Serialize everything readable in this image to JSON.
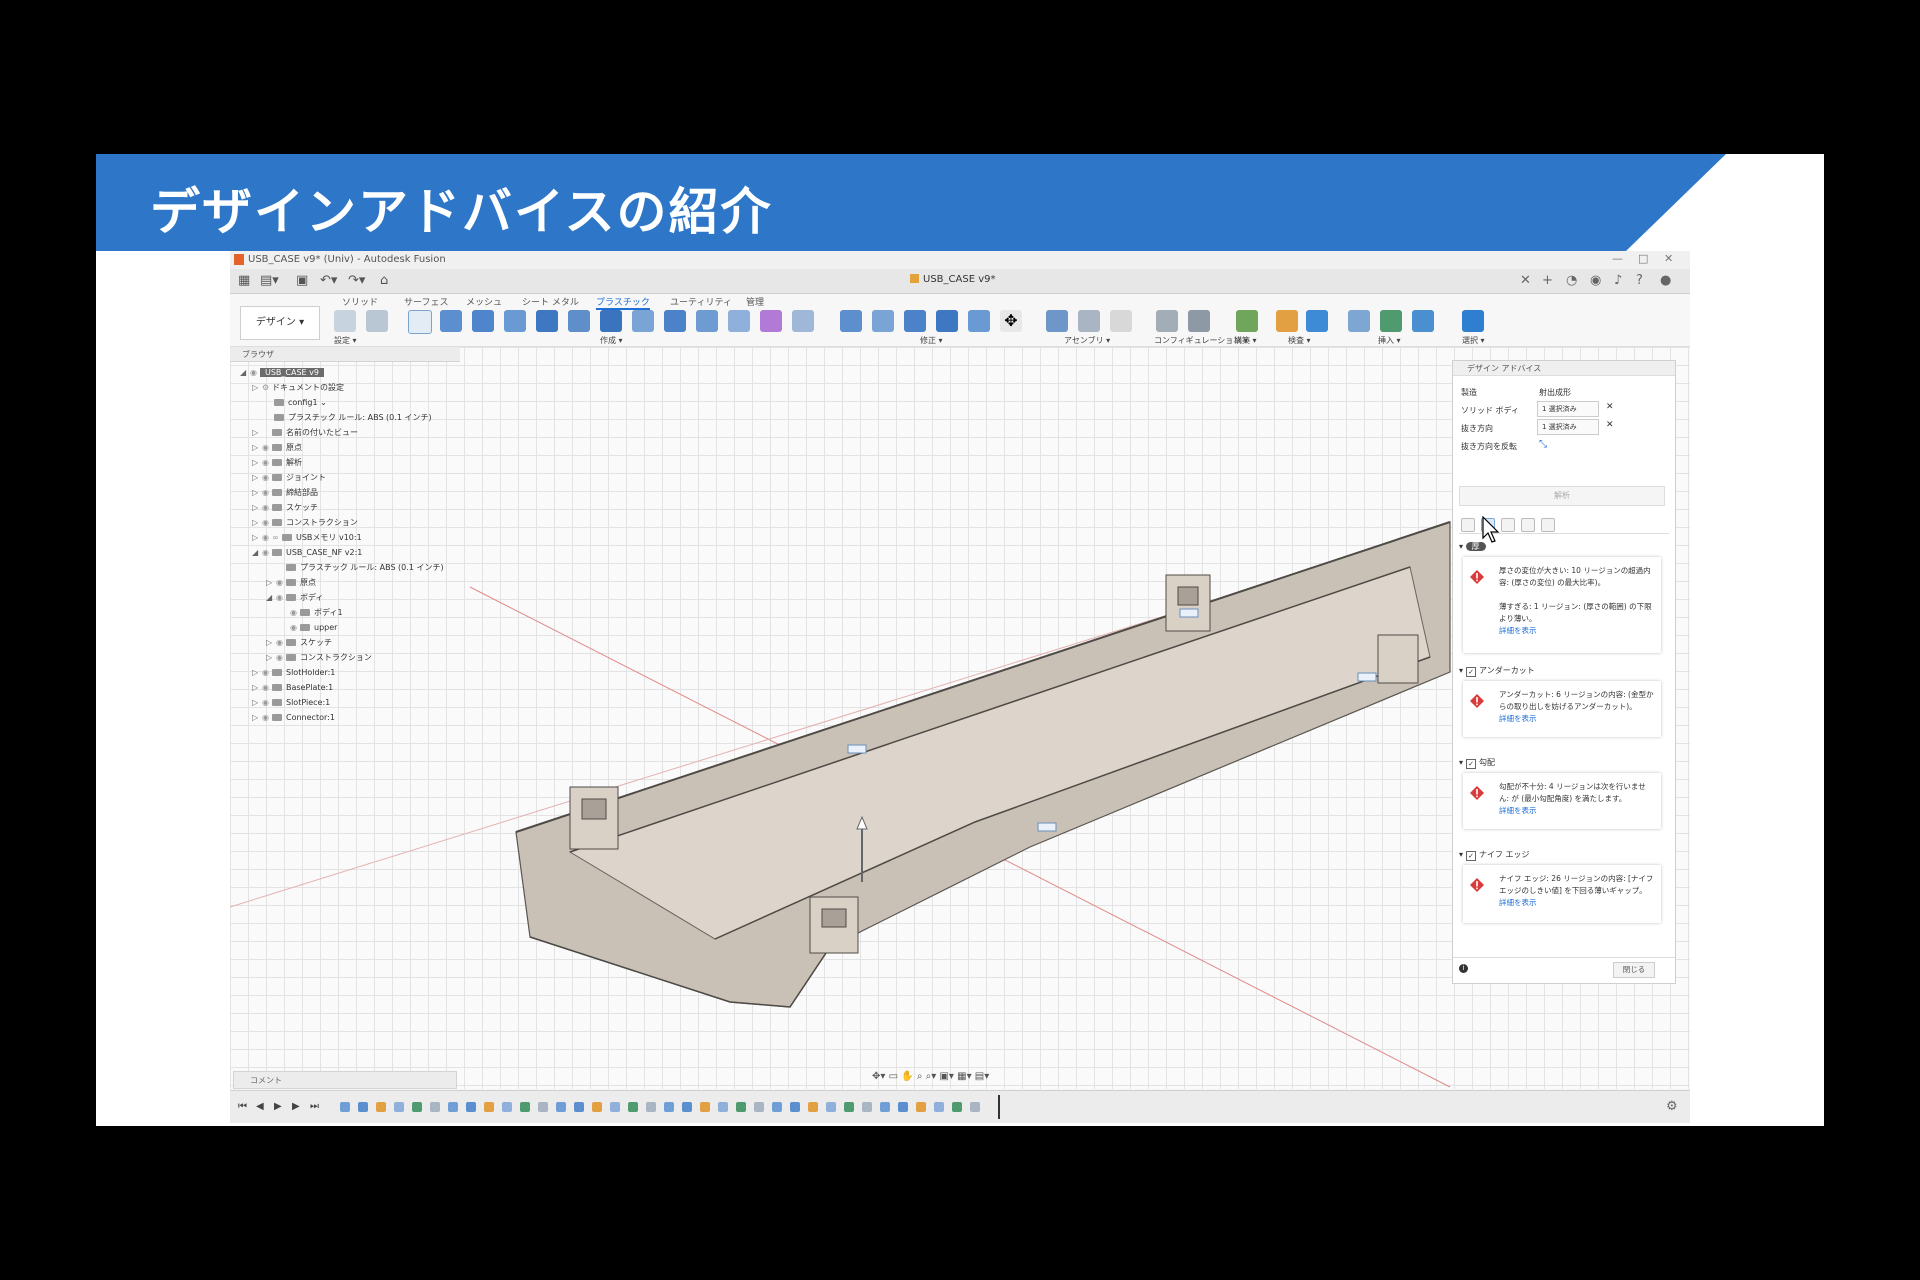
{
  "slide": {
    "title": "デザインアドバイスの紹介"
  },
  "app": {
    "window_title": "USB_CASE v9* (Univ) - Autodesk Fusion",
    "document_tab": "USB_CASE v9*"
  },
  "ribbon": {
    "workspace_button": "デザイン ▾",
    "tabs": [
      "ソリッド",
      "サーフェス",
      "メッシュ",
      "シート メタル",
      "プラスチック",
      "ユーティリティ",
      "管理"
    ],
    "active_tab": "プラスチック",
    "groups": [
      "設定 ▾",
      "作成 ▾",
      "修正 ▾",
      "アセンブリ ▾",
      "コンフィギュレーション ▾",
      "構築 ▾",
      "検査 ▾",
      "挿入 ▾",
      "選択 ▾"
    ]
  },
  "browser": {
    "title": "ブラウザ",
    "root": "USB_CASE v9",
    "items": [
      "ドキュメントの設定",
      "config1",
      "プラスチック ルール: ABS (0.1 インチ)",
      "名前の付いたビュー",
      "原点",
      "解析",
      "ジョイント",
      "締結部品",
      "スケッチ",
      "コンストラクション",
      "USBメモリ v10:1",
      "USB_CASE_NF v2:1",
      "プラスチック ルール: ABS (0.1 インチ)",
      "原点",
      "ボディ",
      "ボディ1",
      "upper",
      "スケッチ",
      "コンストラクション",
      "SlotHolder:1",
      "BasePlate:1",
      "SlotPiece:1",
      "Connector:1"
    ]
  },
  "comment_bar": "コメント",
  "panel": {
    "title": "デザイン アドバイス",
    "process_label": "製造",
    "process_value": "射出成形",
    "solid_body_label": "ソリッド ボディ",
    "solid_body_value": "1 選択済み",
    "pull_dir_label": "抜き方向",
    "pull_dir_value": "1 選択済み",
    "flip_label": "抜き方向を反転",
    "analyze_button": "解析",
    "thickness_section": "厚",
    "thickness_card_1": "厚さの変位が大きい: 10 リージョンの超過内容: (厚さの変位) の最大比率)。",
    "thickness_card_2": "薄すぎる: 1 リージョン: (厚さの範囲) の下限より薄い。",
    "undercut_section": "アンダーカット",
    "undercut_card": "アンダーカット: 6 リージョンの内容: (金型からの取り出しを妨げるアンダーカット)。",
    "draft_section": "勾配",
    "draft_card": "勾配が不十分: 4 リージョンは次を行いません: が (最小勾配角度) を満たします。",
    "knife_section": "ナイフ エッジ",
    "knife_card": "ナイフ エッジ: 26 リージョンの内容: [ナイフ エッジのしきい値] を下回る薄いギャップ。",
    "details_link": "詳細を表示",
    "close_button": "閉じる"
  },
  "colors": {
    "banner": "#2e77c8",
    "accent": "#1f6fd6",
    "warning": "#d83b3b",
    "model": "#d6cfc6"
  }
}
